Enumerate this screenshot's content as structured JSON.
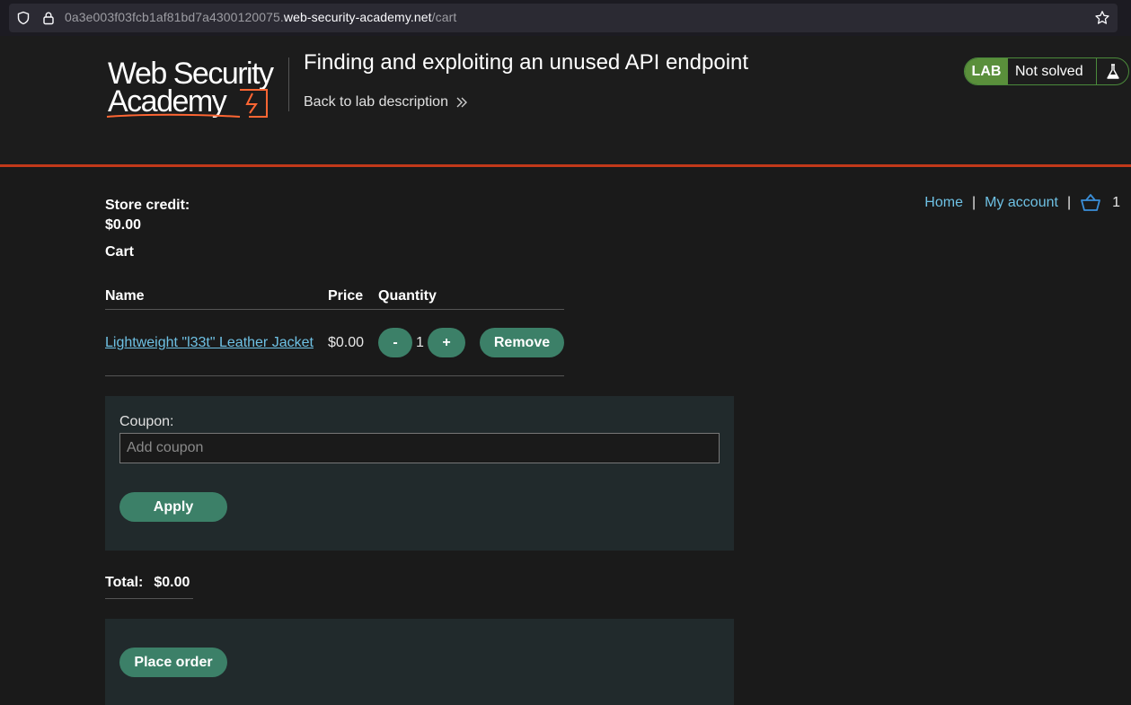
{
  "browser": {
    "url_prefix": "0a3e003f03fcb1af81bd7a4300120075.",
    "url_host": "web-security-academy.net",
    "url_path": "/cart"
  },
  "header": {
    "logo_text": "Web Security Academy",
    "lab_title": "Finding and exploiting an unused API endpoint",
    "back_link": "Back to lab description",
    "lab_badge": "LAB",
    "lab_status": "Not solved"
  },
  "nav": {
    "home": "Home",
    "separator": "|",
    "my_account": "My account",
    "cart_count": "1"
  },
  "store": {
    "credit_label": "Store credit:",
    "credit_value": "$0.00",
    "cart_heading": "Cart"
  },
  "cart": {
    "columns": {
      "name": "Name",
      "price": "Price",
      "quantity": "Quantity"
    },
    "items": [
      {
        "name": "Lightweight \"l33t\" Leather Jacket",
        "price": "$0.00",
        "quantity": "1",
        "decrement": "-",
        "increment": "+",
        "remove": "Remove"
      }
    ]
  },
  "coupon": {
    "label": "Coupon:",
    "placeholder": "Add coupon",
    "apply": "Apply"
  },
  "total": {
    "label": "Total:",
    "value": "$0.00"
  },
  "order": {
    "place_order": "Place order"
  },
  "colors": {
    "accent_button": "#3c8068",
    "link": "#6ec1e4",
    "header_rule": "#c2391a",
    "lab_badge": "#5a8f3b"
  }
}
